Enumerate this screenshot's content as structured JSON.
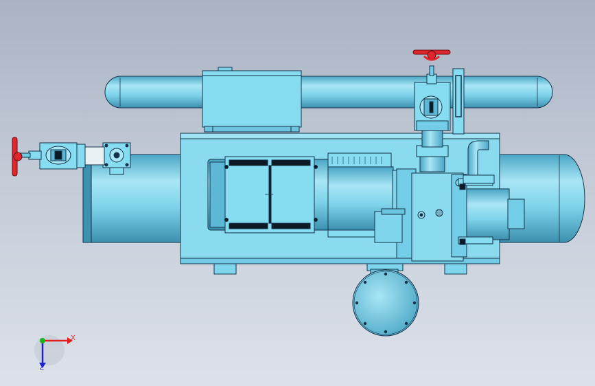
{
  "colors": {
    "metal": "#7fd6ec",
    "metal_light": "#b4ecfa",
    "metal_dark": "#3d97b6",
    "edge": "#14324a",
    "dark": "#0d1a24",
    "valve_red": "#e0262d",
    "background_top": "#a9b3c3",
    "background_bottom": "#dde2ea"
  },
  "icons": [
    "gate-valve-handwheel-icon",
    "pressure-gauge-icon",
    "coordinate-triad-icon"
  ],
  "axes": {
    "x_label": "X",
    "z_label": "Z"
  }
}
